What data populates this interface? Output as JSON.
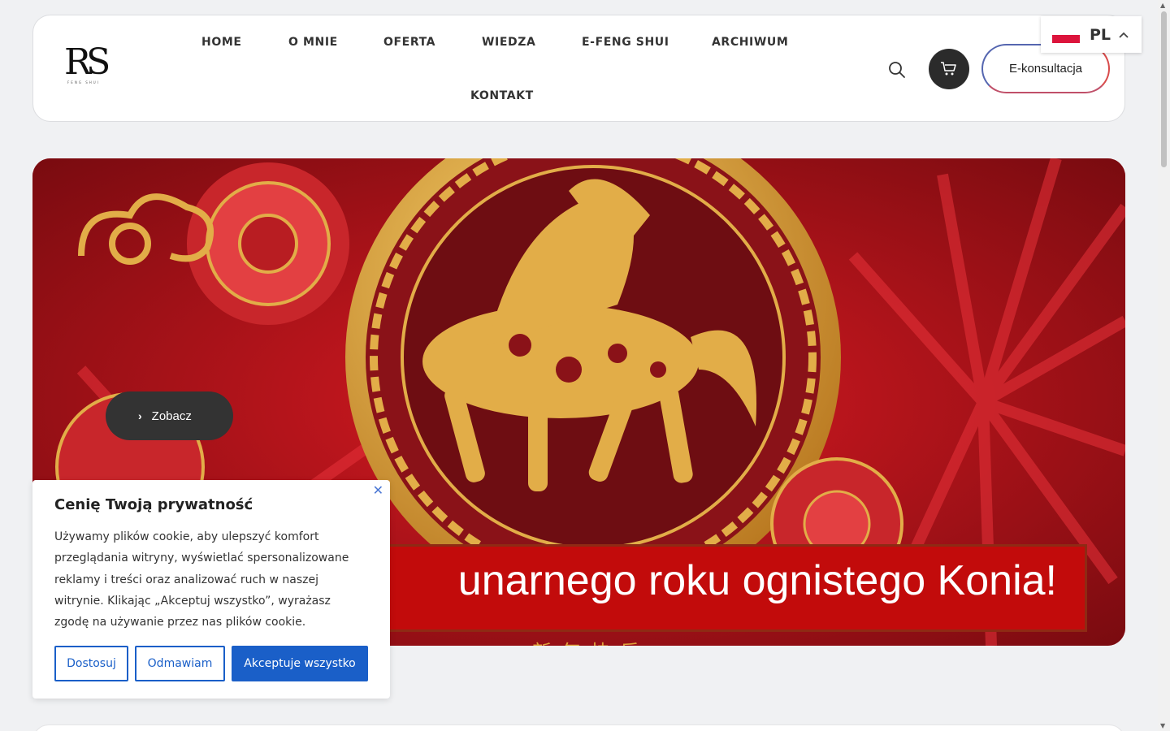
{
  "header": {
    "logo_text": "RS",
    "logo_sub": "FENG SHUI",
    "nav": [
      "HOME",
      "O MNIE",
      "OFERTA",
      "WIEDZA",
      "E-FENG SHUI",
      "ARCHIWUM",
      "KONTAKT"
    ],
    "cta_label": "E-konsultacja"
  },
  "language": {
    "code": "PL"
  },
  "hero": {
    "button_label": "Zobacz",
    "banner_text": "unarnego roku ognistego Konia!",
    "chinese_text": "新年快乐"
  },
  "cookie": {
    "title": "Cenię Twoją prywatność",
    "text": "Używamy plików cookie, aby ulepszyć komfort przeglądania witryny, wyświetlać spersonalizowane reklamy i treści oraz analizować ruch w naszej witrynie. Klikając „Akceptuj wszystko”, wyrażasz zgodę na używanie przez nas plików cookie.",
    "buttons": {
      "customize": "Dostosuj",
      "reject": "Odmawiam",
      "accept": "Akceptuje wszystko"
    }
  },
  "colors": {
    "accent_blue": "#1a5fc8",
    "hero_red": "#c20b0b",
    "gold": "#e0a33a"
  }
}
